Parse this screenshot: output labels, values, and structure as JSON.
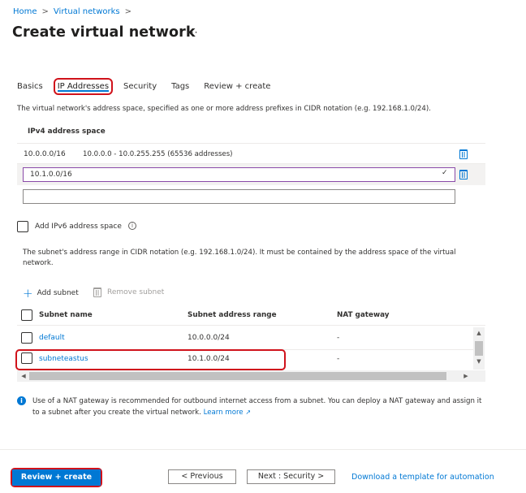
{
  "breadcrumb": {
    "items": [
      "Home",
      "Virtual networks"
    ],
    "separator": ">"
  },
  "page": {
    "title": "Create virtual network",
    "more": "···"
  },
  "tabs": [
    {
      "label": "Basics",
      "active": false
    },
    {
      "label": "IP Addresses",
      "active": true
    },
    {
      "label": "Security",
      "active": false
    },
    {
      "label": "Tags",
      "active": false
    },
    {
      "label": "Review + create",
      "active": false
    }
  ],
  "ipv4": {
    "description": "The virtual network's address space, specified as one or more address prefixes in CIDR notation (e.g. 192.168.1.0/24).",
    "header": "IPv4 address space",
    "existing_prefix": "10.0.0.0/16",
    "existing_range": "10.0.0.0 - 10.0.255.255 (65536 addresses)",
    "new_prefix_value": "10.1.0.0/16",
    "empty_value": ""
  },
  "ipv6": {
    "label": "Add IPv6 address space",
    "checked": false
  },
  "subnets": {
    "description": "The subnet's address range in CIDR notation (e.g. 192.168.1.0/24). It must be contained by the address space of the virtual network.",
    "add_label": "Add subnet",
    "remove_label": "Remove subnet",
    "columns": [
      "Subnet name",
      "Subnet address range",
      "NAT gateway"
    ],
    "rows": [
      {
        "name": "default",
        "range": "10.0.0.0/24",
        "nat": "-"
      },
      {
        "name": "subneteastus",
        "range": "10.1.0.0/24",
        "nat": "-"
      }
    ]
  },
  "info": {
    "text": "Use of a NAT gateway is recommended for outbound internet access from a subnet. You can deploy a NAT gateway and assign it to a subnet after you create the virtual network.",
    "link": "Learn more"
  },
  "footer": {
    "review_create": "Review + create",
    "previous": "< Previous",
    "next": "Next : Security >",
    "download": "Download a template for automation"
  },
  "colors": {
    "accent": "#0078d4",
    "highlight": "#d0121b",
    "focus": "#8a4aa8",
    "success": "#107c10"
  }
}
